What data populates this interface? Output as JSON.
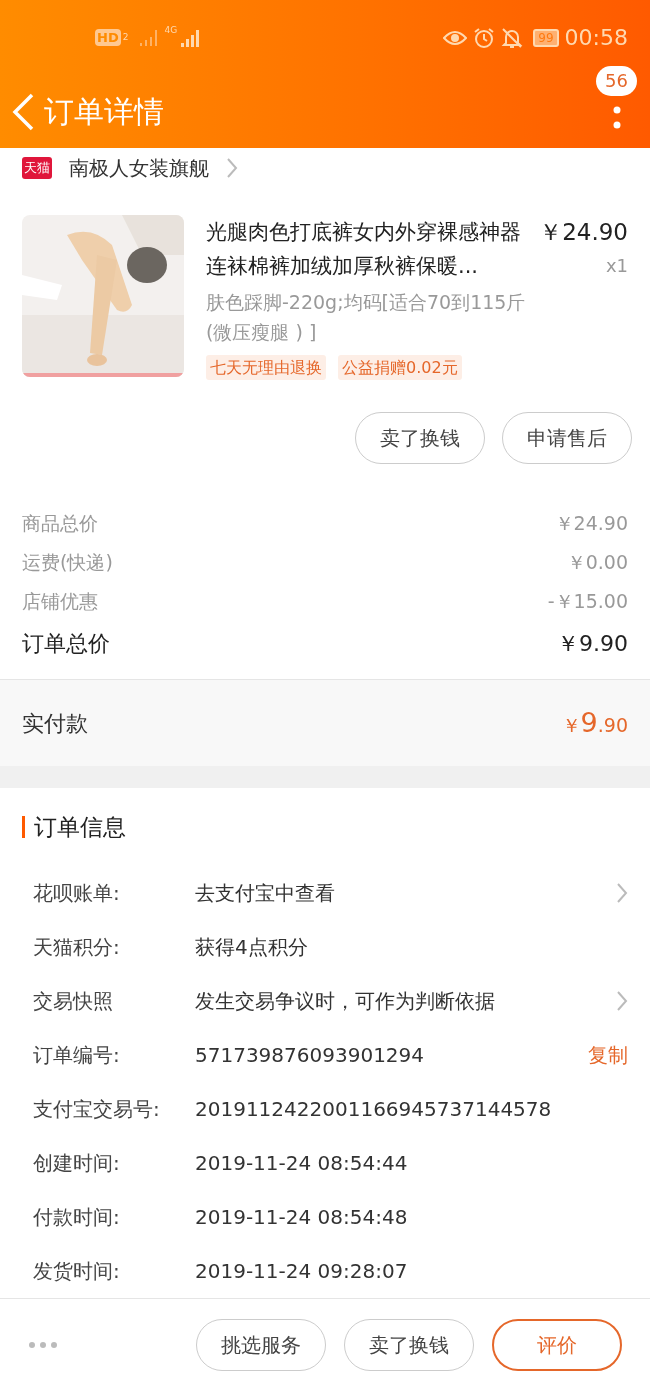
{
  "status_bar": {
    "hd": "HD",
    "sim": "2",
    "network": "4G",
    "battery": "99",
    "time": "00:58"
  },
  "header": {
    "title": "订单详情",
    "badge": "56"
  },
  "store": {
    "badge": "天猫",
    "name": "南极人女装旗舰"
  },
  "product": {
    "kind": "picture",
    "title": "光腿肉色打底裤女内外穿裸感神器连袜棉裤加绒加厚秋裤保暖...",
    "price": "￥24.90",
    "quantity": "x1",
    "sku": "肤色踩脚-220g;均码[适合70到115斤(微压瘦腿 ) ]",
    "tags": [
      "七天无理由退换",
      "公益捐赠0.02元"
    ],
    "buttons": [
      "卖了换钱",
      "申请售后"
    ]
  },
  "summary": {
    "rows": [
      {
        "label": "商品总价",
        "value": "￥24.90"
      },
      {
        "label": "运费(快递)",
        "value": "￥0.00"
      },
      {
        "label": "店铺优惠",
        "value": "-￥15.00"
      }
    ],
    "total": {
      "label": "订单总价",
      "value": "￥9.90"
    },
    "paid": {
      "label": "实付款",
      "currency": "￥",
      "integer": "9",
      "decimal": ".90"
    }
  },
  "order_info": {
    "title": "订单信息",
    "rows": [
      {
        "label": "花呗账单:",
        "value": "去支付宝中查看",
        "kind": "link"
      },
      {
        "label": "天猫积分:",
        "value": "获得4点积分",
        "kind": "plain"
      },
      {
        "label": "交易快照",
        "value": "发生交易争议时，可作为判断依据",
        "kind": "link"
      },
      {
        "label": "订单编号:",
        "value": "571739876093901294",
        "kind": "copy",
        "action": "复制"
      },
      {
        "label": "支付宝交易号:",
        "value": "2019112422001166945737144578",
        "kind": "plain"
      },
      {
        "label": "创建时间:",
        "value": "2019-11-24 08:54:44",
        "kind": "plain"
      },
      {
        "label": "付款时间:",
        "value": "2019-11-24 08:54:48",
        "kind": "plain"
      },
      {
        "label": "发货时间:",
        "value": "2019-11-24 09:28:07",
        "kind": "plain"
      }
    ]
  },
  "bottom_bar": {
    "buttons": [
      {
        "label": "挑选服务",
        "primary": false
      },
      {
        "label": "卖了换钱",
        "primary": false
      },
      {
        "label": "评价",
        "primary": true
      }
    ]
  }
}
